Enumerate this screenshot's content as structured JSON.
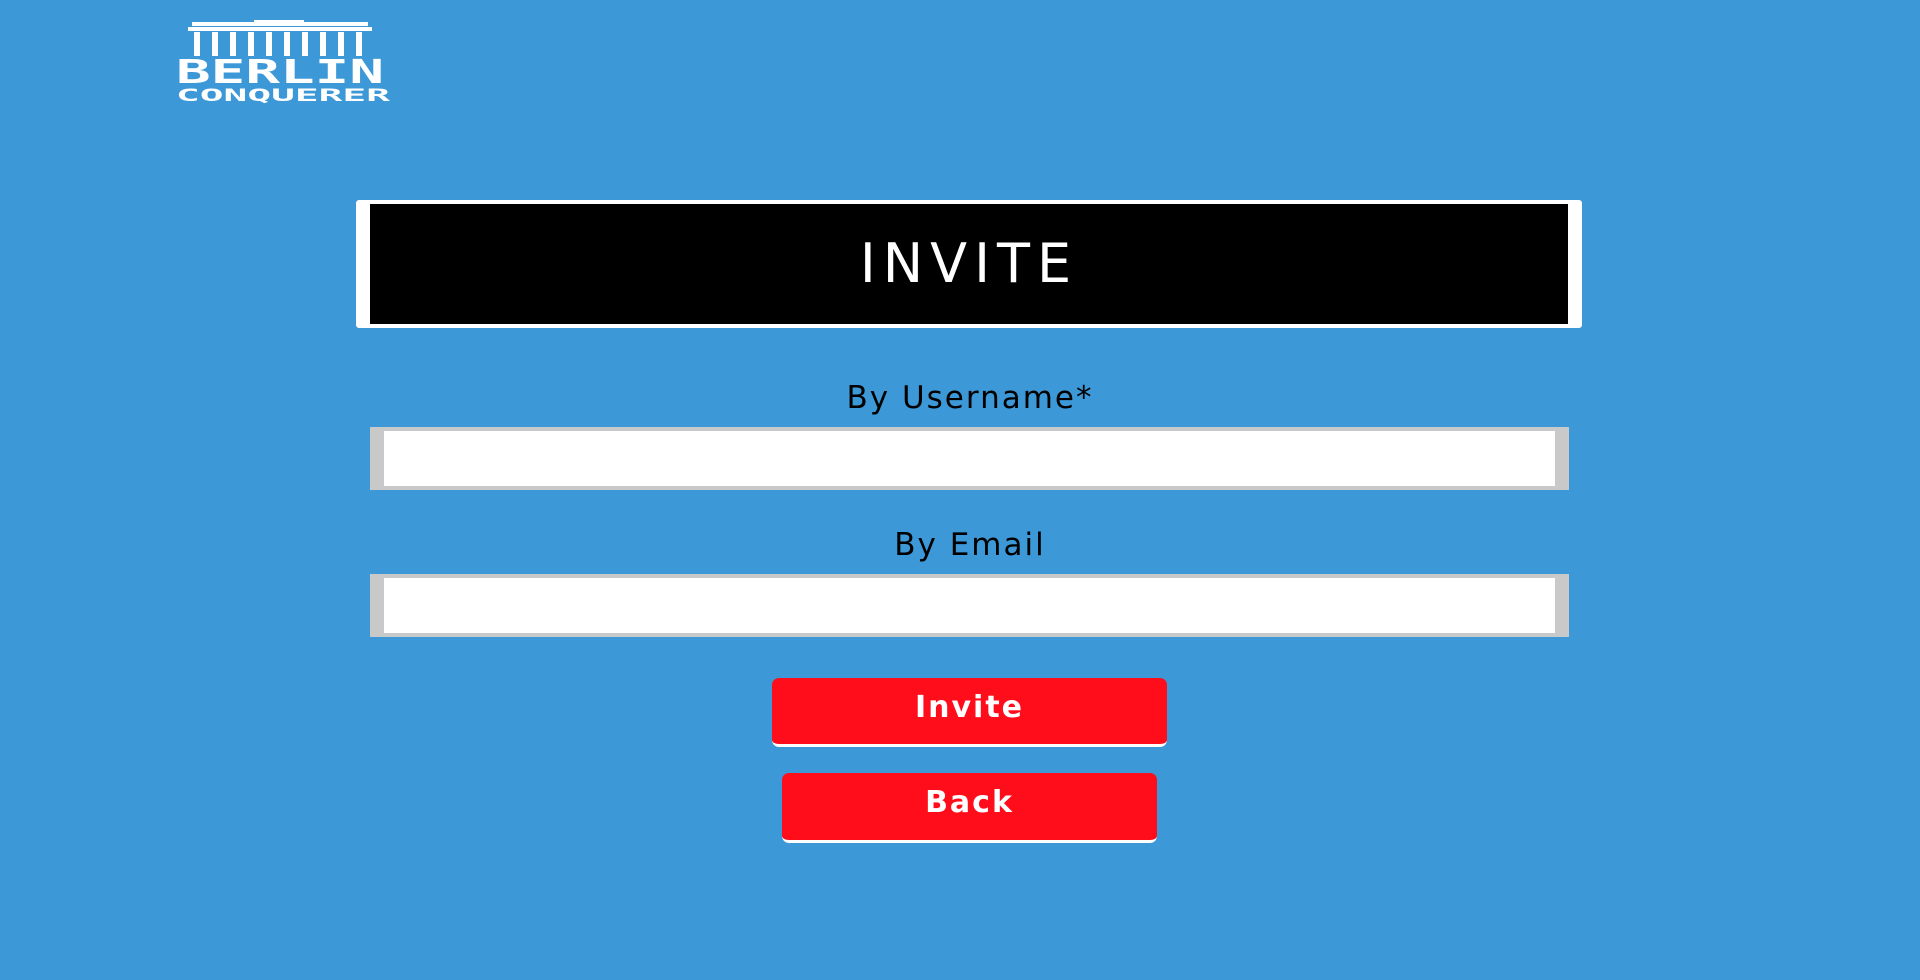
{
  "logo": {
    "line1": "BERLIN",
    "line2": "CONQUERER"
  },
  "title": "INVITE",
  "form": {
    "username_label": "By Username*",
    "username_value": "",
    "email_label": "By Email",
    "email_value": ""
  },
  "buttons": {
    "invite_label": "Invite",
    "back_label": "Back"
  },
  "colors": {
    "background": "#3c98d7",
    "button": "#ff0d1b",
    "title_box": "#000000"
  }
}
